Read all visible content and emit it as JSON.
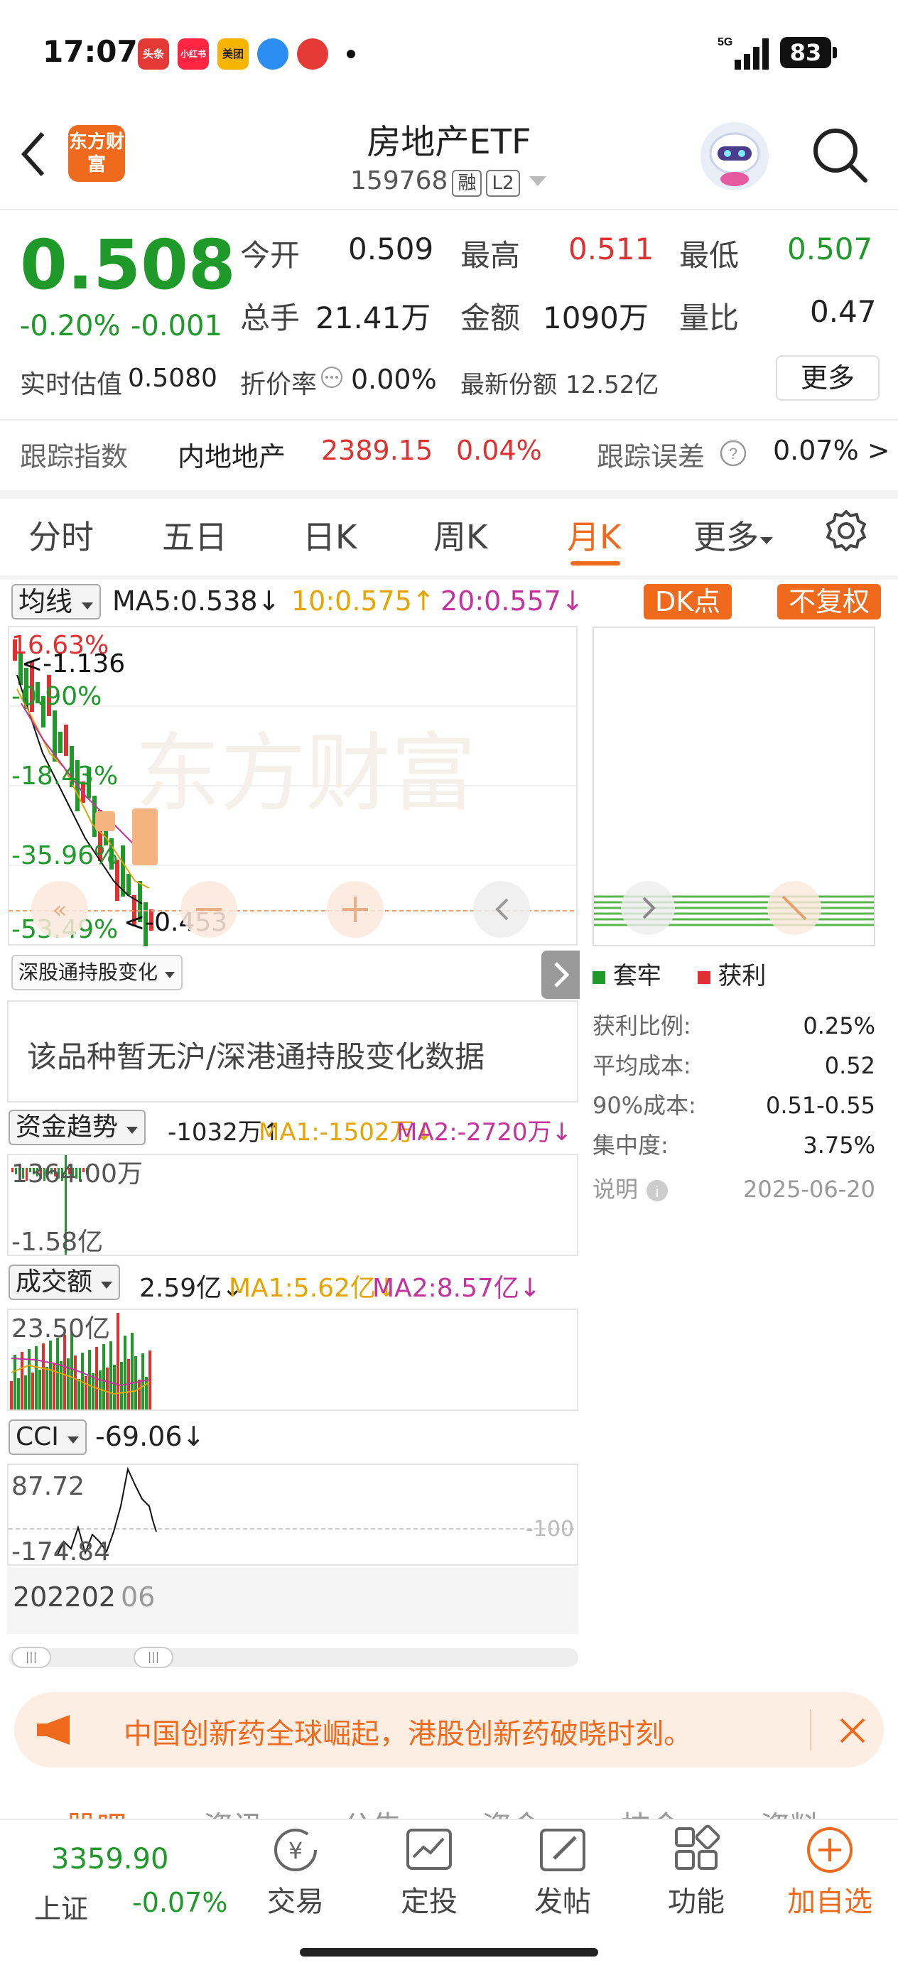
{
  "status_bar": {
    "time": "17:07",
    "apps": [
      {
        "label": "头条",
        "color": "#e53935"
      },
      {
        "label": "小红书",
        "color": "#ff2442"
      },
      {
        "label": "美团",
        "color": "#f5b400"
      },
      {
        "label": "",
        "color": "#2b8cf2"
      },
      {
        "label": "",
        "color": "#e53935"
      }
    ],
    "network": "5G",
    "battery": "83"
  },
  "header": {
    "title": "房地产ETF",
    "code": "159768",
    "tag_rong": "融",
    "tag_l2": "L2",
    "logo_text": "东方财富"
  },
  "quote": {
    "price": "0.508",
    "change_pct": "-0.20%",
    "change": "-0.001",
    "open_label": "今开",
    "open": "0.509",
    "high_label": "最高",
    "high": "0.511",
    "low_label": "最低",
    "low": "0.507",
    "vol_label": "总手",
    "vol": "21.41万",
    "amount_label": "金额",
    "amount": "1090万",
    "ratio_label": "量比",
    "ratio": "0.47",
    "iopv_label": "实时估值",
    "iopv": "0.5080",
    "discount_label": "折价率",
    "discount": "0.00%",
    "shares_label": "最新份额",
    "shares": "12.52亿",
    "more_btn": "更多"
  },
  "tracking": {
    "label": "跟踪指数",
    "index": "内地地产",
    "index_value": "2389.15",
    "index_pct": "0.04%",
    "error_label": "跟踪误差",
    "error": "0.07% >"
  },
  "tabs": [
    {
      "label": "分时"
    },
    {
      "label": "五日"
    },
    {
      "label": "日K"
    },
    {
      "label": "周K"
    },
    {
      "label": "月K"
    },
    {
      "label": "更多"
    }
  ],
  "kline": {
    "ma_select": "均线",
    "ma5": "MA5:0.538↓",
    "ma10": "10:0.575↑",
    "ma20": "20:0.557↓",
    "dk_btn": "DK点",
    "fq_btn": "不复权",
    "y_top": "16.63%",
    "y2": "-0.90%",
    "y3": "-18.43%",
    "y4": "-35.96%",
    "y5": "-53.49%",
    "max_mark": "<-1.136",
    "min_mark": "<-0.453",
    "watermark": "东方财富",
    "colors": {
      "up": "#e03131",
      "down": "#1f9a2a"
    }
  },
  "chip": {
    "legend_loss": "套牢",
    "legend_profit": "获利",
    "profit_ratio_label": "获利比例:",
    "profit_ratio": "0.25%",
    "avg_cost_label": "平均成本:",
    "avg_cost": "0.52",
    "cost90_label": "90%成本:",
    "cost90": "0.51-0.55",
    "concentration_label": "集中度:",
    "concentration": "3.75%",
    "note_label": "说明",
    "date": "2025-06-20"
  },
  "hk_hold": {
    "select": "深股通持股变化",
    "message": "该品种暂无沪/深港通持股变化数据"
  },
  "fund": {
    "select": "资金趋势",
    "value": "-1032万↑",
    "ma1": "MA1:-1502万↓",
    "ma2": "MA2:-2720万↓",
    "y_top": "1364.00万",
    "y_bottom": "-1.58亿"
  },
  "turnover": {
    "select": "成交额",
    "value": "2.59亿↓",
    "ma1": "MA1:5.62亿↓",
    "ma2": "MA2:8.57亿↓",
    "y_top": "23.50亿"
  },
  "cci": {
    "select": "CCI",
    "value": "-69.06↓",
    "y_top": "87.72",
    "y_bottom": "-174.84",
    "ref": "-100",
    "date_label": "202202",
    "date_tail": "06"
  },
  "notice": {
    "text": "中国创新药全球崛起，港股创新药破晓时刻。"
  },
  "bottom_tabs_faded": [
    "股吧",
    "资讯",
    "公告",
    "资金",
    "技金",
    "资料"
  ],
  "bottom_nav": {
    "index_value": "3359.90",
    "index_name": "上证",
    "index_pct": "-0.07%",
    "items": [
      {
        "label": "交易"
      },
      {
        "label": "定投"
      },
      {
        "label": "发帖"
      },
      {
        "label": "功能"
      },
      {
        "label": "加自选"
      }
    ]
  }
}
